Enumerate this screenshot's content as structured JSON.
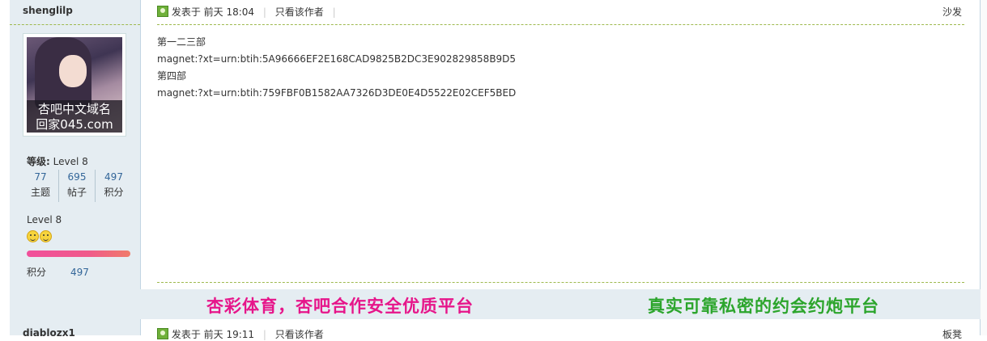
{
  "post": {
    "author": "shenglilp",
    "avatar_caption_line1": "杏吧中文域名",
    "avatar_caption_line2": "回家045.com",
    "level_label": "等级:",
    "level_value": "Level 8",
    "stats": [
      {
        "value": "77",
        "label": "主题"
      },
      {
        "value": "695",
        "label": "帖子"
      },
      {
        "value": "497",
        "label": "积分"
      }
    ],
    "rank_title": "Level 8",
    "points_label": "积分",
    "points_value": "497",
    "posted_prefix": "发表于",
    "posted_time": "前天 18:04",
    "only_author_link": "只看该作者",
    "floor_label": "沙发",
    "content_lines": [
      "第一二三部",
      "magnet:?xt=urn:btih:5A96666EF2E168CAD9825B2DC3E902829858B9D5",
      "第四部",
      "magnet:?xt=urn:btih:759FBF0B1582AA7326D3DE0E4D5522E02CEF5BED"
    ]
  },
  "ads": {
    "left_text": "杏彩体育，杏吧合作安全优质平台",
    "right_text": "真实可靠私密的约会约炮平台",
    "left_color": "#e6158a",
    "right_color": "#2ca52c"
  },
  "next_post": {
    "author": "diablozx1",
    "posted_prefix": "发表于",
    "posted_time": "前天 19:11",
    "only_author_link": "只看该作者",
    "floor_label": "板凳"
  },
  "icons": [
    "post-status-icon",
    "smiley-icon"
  ]
}
